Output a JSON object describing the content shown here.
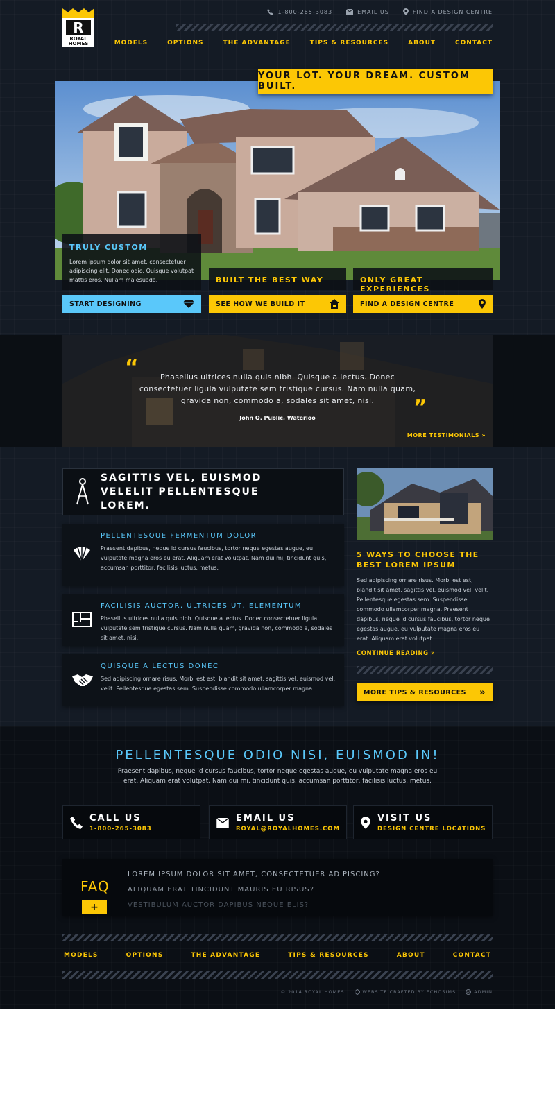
{
  "brand": {
    "logo_line1": "ROYAL",
    "logo_line2": "HOMES"
  },
  "topbar": {
    "phone": "1-800-265-3083",
    "email": "EMAIL US",
    "find": "FIND A DESIGN CENTRE"
  },
  "nav": [
    "MODELS",
    "OPTIONS",
    "THE ADVANTAGE",
    "TIPS & RESOURCES",
    "ABOUT",
    "CONTACT"
  ],
  "hero": {
    "tagline": "YOUR LOT. YOUR DREAM. CUSTOM BUILT.",
    "card1": {
      "title": "TRULY CUSTOM",
      "text": "Lorem ipsum dolor sit amet, consectetuer adipiscing elit. Donec odio. Quisque volutpat mattis eros. Nullam malesuada.",
      "button": "START DESIGNING"
    },
    "card2": {
      "title": "BUILT THE BEST WAY",
      "button": "SEE HOW WE BUILD IT"
    },
    "card3": {
      "title": "ONLY GREAT EXPERIENCES",
      "button": "FIND A DESIGN CENTRE"
    }
  },
  "testimonial": {
    "quote": "Phasellus ultrices nulla quis nibh. Quisque a lectus. Donec consectetuer ligula vulputate sem tristique cursus. Nam nulla quam, gravida non, commodo a, sodales sit amet, nisi.",
    "author": "John Q. Public, Waterloo",
    "more": "MORE TESTIMONIALS »"
  },
  "features": {
    "heading": "SAGITTIS VEL, EUISMOD VELELIT PELLENTESQUE LOREM.",
    "items": [
      {
        "title": "PELLENTESQUE FERMENTUM DOLOR",
        "text": "Praesent dapibus, neque id cursus faucibus, tortor neque egestas augue, eu vulputate magna eros eu erat. Aliquam erat volutpat. Nam dui mi, tincidunt quis, accumsan porttitor, facilisis luctus, metus.",
        "icon": "fan-swatch-icon"
      },
      {
        "title": "FACILISIS AUCTOR, ULTRICES UT, ELEMENTUM",
        "text": "Phasellus ultrices nulla quis nibh. Quisque a lectus. Donec consectetuer ligula vulputate sem tristique cursus. Nam nulla quam, gravida non, commodo a, sodales sit amet, nisi.",
        "icon": "floorplan-icon"
      },
      {
        "title": "QUISQUE A LECTUS DONEC",
        "text": "Sed adipiscing ornare risus. Morbi est est, blandit sit amet, sagittis vel, euismod vel, velit. Pellentesque egestas sem. Suspendisse commodo ullamcorper magna.",
        "icon": "handshake-icon"
      }
    ]
  },
  "sidebar": {
    "title": "5 WAYS TO CHOOSE THE BEST LOREM IPSUM",
    "text": "Sed adipiscing ornare risus. Morbi est est, blandit sit amet, sagittis vel, euismod vel, velit. Pellentesque egestas sem. Suspendisse commodo ullamcorper magna. Praesent dapibus, neque id cursus faucibus, tortor neque egestas augue, eu vulputate magna eros eu erat. Aliquam erat volutpat.",
    "continue": "CONTINUE READING »",
    "button": "MORE TIPS & RESOURCES"
  },
  "contact": {
    "heading": "PELLENTESQUE ODIO NISI, EUISMOD IN!",
    "text": "Praesent dapibus, neque id cursus faucibus, tortor neque egestas augue, eu vulputate magna eros eu erat. Aliquam erat volutpat. Nam dui mi, tincidunt quis, accumsan porttitor, facilisis luctus, metus.",
    "call": {
      "title": "CALL US",
      "sub": "1-800-265-3083"
    },
    "email": {
      "title": "EMAIL US",
      "sub": "ROYAL@ROYALHOMES.COM"
    },
    "visit": {
      "title": "VISIT US",
      "sub": "DESIGN CENTRE LOCATIONS"
    }
  },
  "faq": {
    "label": "FAQ",
    "toggle": "+",
    "questions": [
      "LOREM IPSUM DOLOR SIT AMET, CONSECTETUER ADIPISCING?",
      "ALIQUAM ERAT TINCIDUNT MAURIS EU RISUS?",
      "VESTIBULUM AUCTOR DAPIBUS NEQUE ELIS?"
    ]
  },
  "footer": {
    "nav": [
      "MODELS",
      "OPTIONS",
      "THE ADVANTAGE",
      "TIPS & RESOURCES",
      "ABOUT",
      "CONTACT"
    ],
    "copyright": "© 2014 ROYAL HOMES",
    "crafted": "WEBSITE CRAFTED BY ECHOSIMS",
    "admin": "ADMIN"
  },
  "colors": {
    "accent": "#fcc705",
    "blue": "#5ac8fa",
    "bg": "#141b25"
  }
}
